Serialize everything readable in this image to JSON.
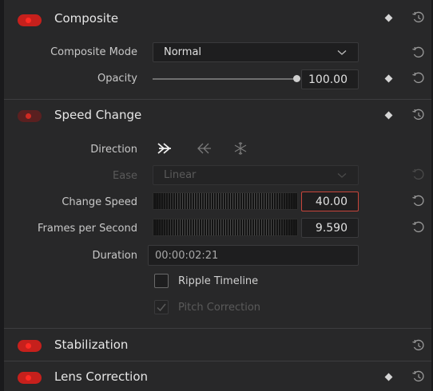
{
  "composite": {
    "title": "Composite",
    "mode_label": "Composite Mode",
    "mode_value": "Normal",
    "opacity_label": "Opacity",
    "opacity_value": "100.00",
    "opacity_level": 1.0
  },
  "speed_change": {
    "title": "Speed Change",
    "direction_label": "Direction",
    "directions": [
      "forward",
      "reverse",
      "freeze"
    ],
    "ease_label": "Ease",
    "ease_value": "Linear",
    "change_speed_label": "Change Speed",
    "change_speed_value": "40.00",
    "fps_label": "Frames per Second",
    "fps_value": "9.590",
    "duration_label": "Duration",
    "duration_value": "00:00:02:21",
    "ripple_label": "Ripple Timeline",
    "ripple_checked": false,
    "pitch_label": "Pitch Correction",
    "pitch_checked": true
  },
  "stabilization": {
    "title": "Stabilization"
  },
  "lens_correction": {
    "title": "Lens Correction"
  },
  "icons": {
    "toggle": "power-toggle-icon",
    "keyframe": "keyframe-diamond-icon",
    "reset": "reset-icon",
    "reset_keyframe": "reset-keyframe-icon",
    "dropdown": "chevron-down-icon"
  },
  "colors": {
    "accent_red": "#e02a22",
    "focus_red": "#c7453b",
    "panel_bg": "#282829"
  }
}
